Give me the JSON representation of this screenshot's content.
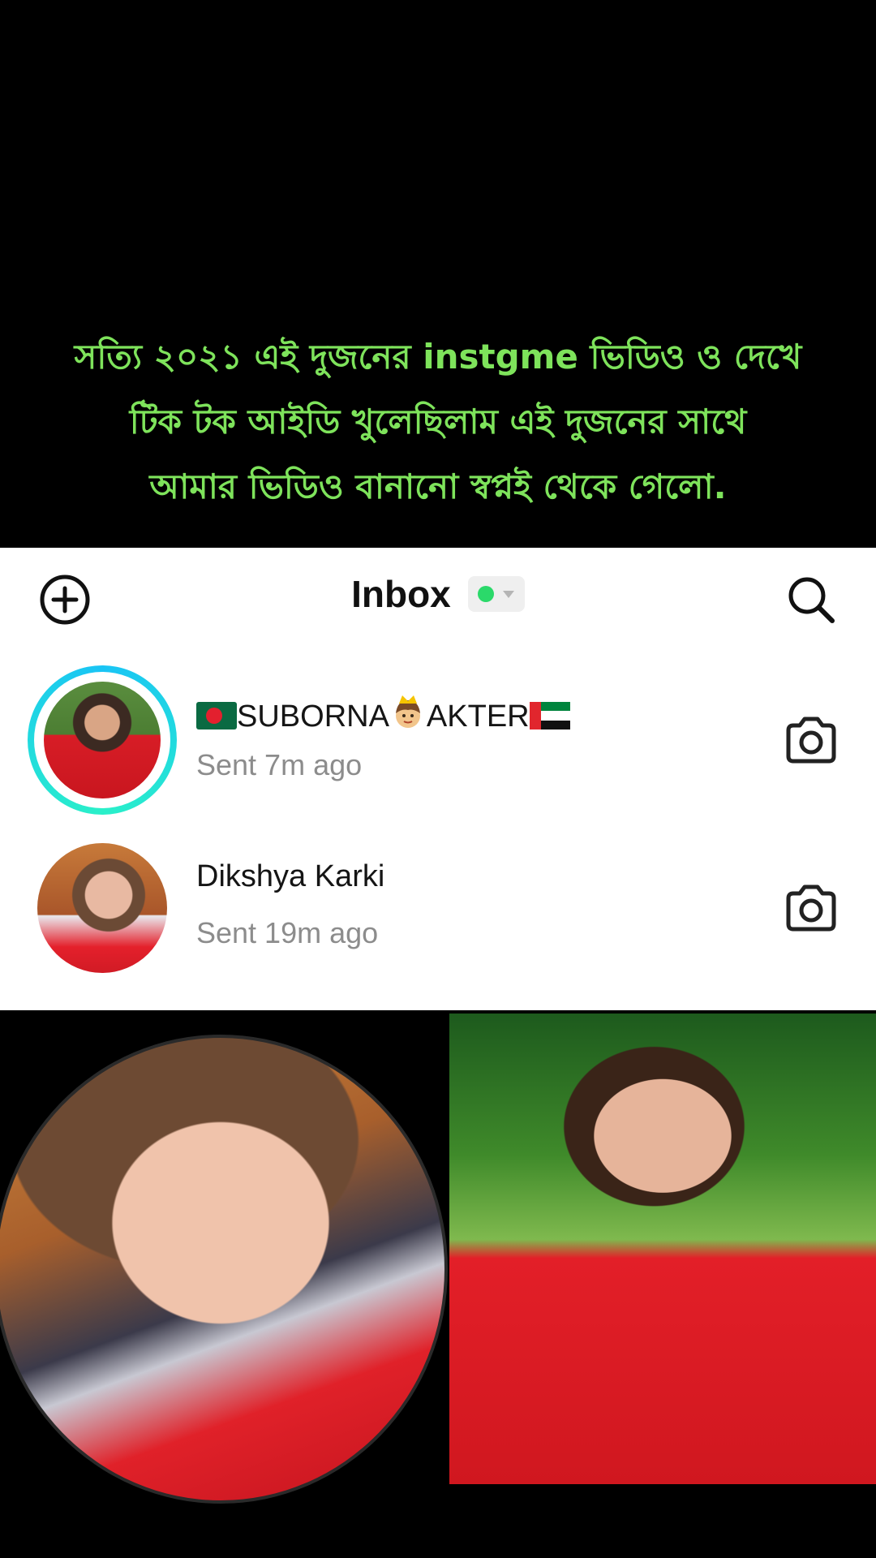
{
  "caption": {
    "lines": [
      "সত্যি  ২০২১ এই দুজনের instgme ভিডিও ও দেখে",
      "টিক টক আইডি খুলেছিলাম এই দুজনের সাথে",
      "আমার ভিডিও বানানো স্বপ্নই থেকে গেলো."
    ],
    "color": "#7ee35b"
  },
  "inbox": {
    "title": "Inbox",
    "status_color": "#2bd96a",
    "left_icon": "plus-circle-icon",
    "right_icon": "search-icon",
    "messages": [
      {
        "name_parts": [
          "SUBORNA",
          "AKTER"
        ],
        "name_emojis": [
          "bangladesh-flag",
          "princess",
          "uae-flag"
        ],
        "status": "Sent 7m ago",
        "has_story_ring": true,
        "action_icon": "camera-icon"
      },
      {
        "name": "Dikshya Karki",
        "status": "Sent 19m ago",
        "has_story_ring": false,
        "action_icon": "camera-icon"
      }
    ]
  }
}
